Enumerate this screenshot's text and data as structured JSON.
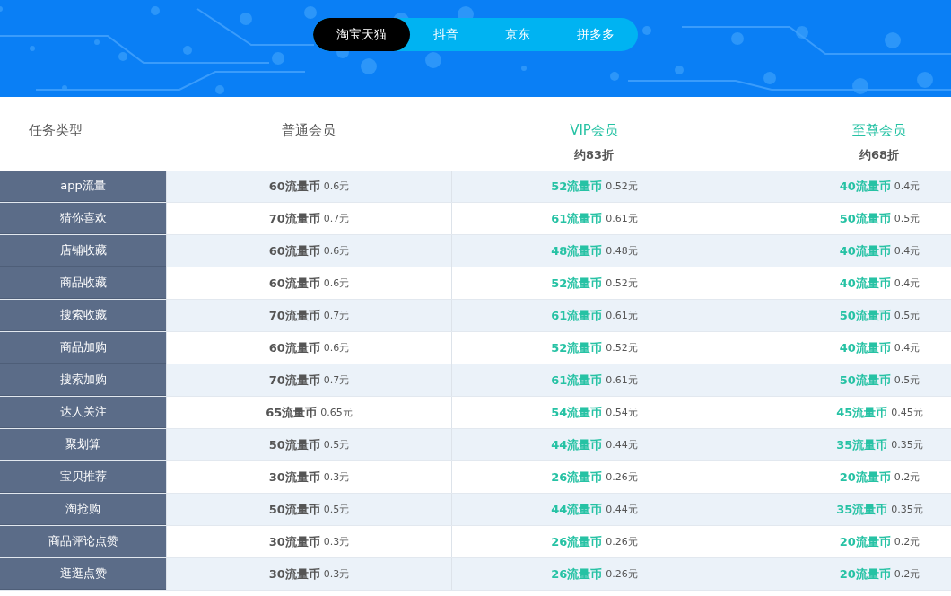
{
  "tabs": [
    {
      "label": "淘宝天猫",
      "selected": true
    },
    {
      "label": "抖音",
      "selected": false
    },
    {
      "label": "京东",
      "selected": false
    },
    {
      "label": "拼多多",
      "selected": false
    }
  ],
  "table": {
    "columns": [
      {
        "label": "任务类型",
        "kind": "plain"
      },
      {
        "label": "普通会员",
        "kind": "plain"
      },
      {
        "label": "VIP会员",
        "kind": "premium",
        "discount": "约83折"
      },
      {
        "label": "至尊会员",
        "kind": "premium",
        "discount": "约68折"
      }
    ],
    "rows": [
      {
        "cells": [
          {
            "kind": "task",
            "text": "app流量"
          },
          {
            "kind": "rate",
            "coins": "60流量币",
            "price": "0.6元"
          },
          {
            "kind": "rate",
            "coins": "52流量币",
            "price": "0.52元"
          },
          {
            "kind": "rate",
            "coins": "40流量币",
            "price": "0.4元"
          }
        ]
      },
      {
        "cells": [
          {
            "kind": "task",
            "text": "猜你喜欢"
          },
          {
            "kind": "rate",
            "coins": "70流量币",
            "price": "0.7元"
          },
          {
            "kind": "rate",
            "coins": "61流量币",
            "price": "0.61元"
          },
          {
            "kind": "rate",
            "coins": "50流量币",
            "price": "0.5元"
          }
        ]
      },
      {
        "cells": [
          {
            "kind": "task",
            "text": "店铺收藏"
          },
          {
            "kind": "rate",
            "coins": "60流量币",
            "price": "0.6元"
          },
          {
            "kind": "rate",
            "coins": "48流量币",
            "price": "0.48元"
          },
          {
            "kind": "rate",
            "coins": "40流量币",
            "price": "0.4元"
          }
        ]
      },
      {
        "cells": [
          {
            "kind": "task",
            "text": "商品收藏"
          },
          {
            "kind": "rate",
            "coins": "60流量币",
            "price": "0.6元"
          },
          {
            "kind": "rate",
            "coins": "52流量币",
            "price": "0.52元"
          },
          {
            "kind": "rate",
            "coins": "40流量币",
            "price": "0.4元"
          }
        ]
      },
      {
        "cells": [
          {
            "kind": "task",
            "text": "搜索收藏"
          },
          {
            "kind": "rate",
            "coins": "70流量币",
            "price": "0.7元"
          },
          {
            "kind": "rate",
            "coins": "61流量币",
            "price": "0.61元"
          },
          {
            "kind": "rate",
            "coins": "50流量币",
            "price": "0.5元"
          }
        ]
      },
      {
        "cells": [
          {
            "kind": "task",
            "text": "商品加购"
          },
          {
            "kind": "rate",
            "coins": "60流量币",
            "price": "0.6元"
          },
          {
            "kind": "rate",
            "coins": "52流量币",
            "price": "0.52元"
          },
          {
            "kind": "rate",
            "coins": "40流量币",
            "price": "0.4元"
          }
        ]
      },
      {
        "cells": [
          {
            "kind": "task",
            "text": "搜索加购"
          },
          {
            "kind": "rate",
            "coins": "70流量币",
            "price": "0.7元"
          },
          {
            "kind": "rate",
            "coins": "61流量币",
            "price": "0.61元"
          },
          {
            "kind": "rate",
            "coins": "50流量币",
            "price": "0.5元"
          }
        ]
      },
      {
        "cells": [
          {
            "kind": "task",
            "text": "达人关注"
          },
          {
            "kind": "rate",
            "coins": "65流量币",
            "price": "0.65元"
          },
          {
            "kind": "rate",
            "coins": "54流量币",
            "price": "0.54元"
          },
          {
            "kind": "rate",
            "coins": "45流量币",
            "price": "0.45元"
          }
        ]
      },
      {
        "cells": [
          {
            "kind": "task",
            "text": "聚划算"
          },
          {
            "kind": "rate",
            "coins": "50流量币",
            "price": "0.5元"
          },
          {
            "kind": "rate",
            "coins": "44流量币",
            "price": "0.44元"
          },
          {
            "kind": "rate",
            "coins": "35流量币",
            "price": "0.35元"
          }
        ]
      },
      {
        "cells": [
          {
            "kind": "task",
            "text": "宝贝推荐"
          },
          {
            "kind": "rate",
            "coins": "30流量币",
            "price": "0.3元"
          },
          {
            "kind": "rate",
            "coins": "26流量币",
            "price": "0.26元"
          },
          {
            "kind": "rate",
            "coins": "20流量币",
            "price": "0.2元"
          }
        ]
      },
      {
        "cells": [
          {
            "kind": "task",
            "text": "淘抢购"
          },
          {
            "kind": "rate",
            "coins": "50流量币",
            "price": "0.5元"
          },
          {
            "kind": "rate",
            "coins": "44流量币",
            "price": "0.44元"
          },
          {
            "kind": "rate",
            "coins": "35流量币",
            "price": "0.35元"
          }
        ]
      },
      {
        "cells": [
          {
            "kind": "task",
            "text": "商品评论点赞"
          },
          {
            "kind": "rate",
            "coins": "30流量币",
            "price": "0.3元"
          },
          {
            "kind": "rate",
            "coins": "26流量币",
            "price": "0.26元"
          },
          {
            "kind": "rate",
            "coins": "20流量币",
            "price": "0.2元"
          }
        ]
      },
      {
        "cells": [
          {
            "kind": "task",
            "text": "逛逛点赞"
          },
          {
            "kind": "rate",
            "coins": "30流量币",
            "price": "0.3元"
          },
          {
            "kind": "rate",
            "coins": "26流量币",
            "price": "0.26元"
          },
          {
            "kind": "rate",
            "coins": "20流量币",
            "price": "0.2元"
          }
        ]
      }
    ]
  }
}
